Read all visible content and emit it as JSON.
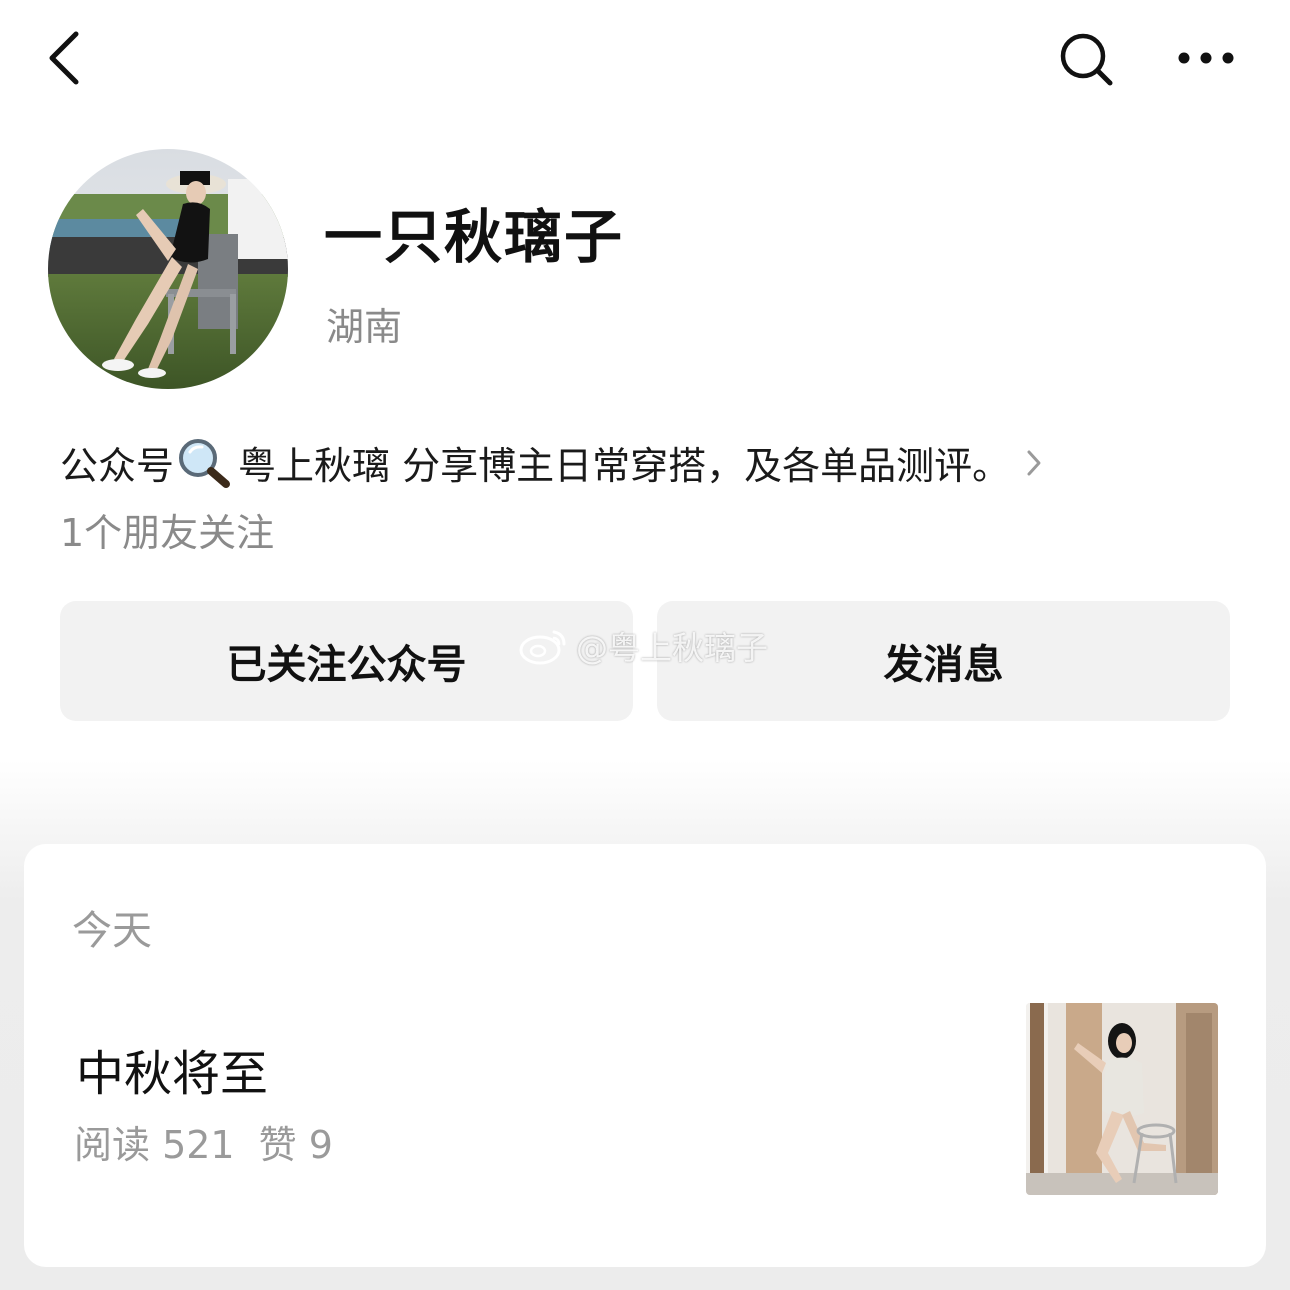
{
  "top_bar": {
    "back_icon": "chevron-left-icon",
    "search_icon": "search-icon",
    "more_icon": "more-dots-icon"
  },
  "profile": {
    "name": "一只秋璃子",
    "region": "湖南",
    "intro_prefix": "公众号",
    "intro_icon": "magnifier-emoji",
    "intro_text": "粤上秋璃 分享博主日常穿搭，及各单品测评。",
    "friends_following": "1个朋友关注"
  },
  "actions": {
    "follow_label": "已关注公众号",
    "message_label": "发消息"
  },
  "watermark": {
    "text": "@粤上秋璃子"
  },
  "articles_section": {
    "date_label": "今天",
    "items": [
      {
        "title": "中秋将至",
        "reads": "阅读 521",
        "likes": "赞 9"
      }
    ]
  },
  "colors": {
    "button_bg": "#f2f2f2",
    "secondary_text": "#8a8a8a",
    "card_bg": "#ffffff",
    "page_bottom_bg": "#ececec"
  }
}
